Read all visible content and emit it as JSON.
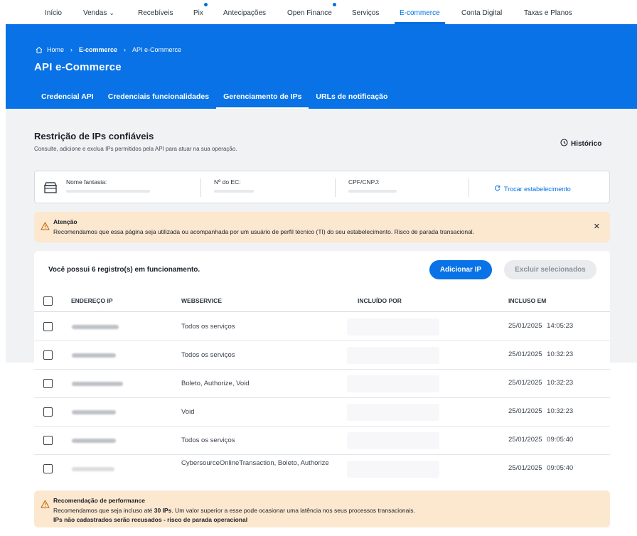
{
  "nav": {
    "items": [
      "Início",
      "Vendas",
      "Recebíveis",
      "Pix",
      "Antecipações",
      "Open Finance",
      "Serviços",
      "E-commerce",
      "Conta Digital",
      "Taxas e Planos"
    ],
    "active": "E-commerce"
  },
  "breadcrumb": {
    "home": "Home",
    "section": "E-commerce",
    "current": "API e-Commerce"
  },
  "page_title": "API e-Commerce",
  "tabs": [
    "Credencial API",
    "Credenciais funcionalidades",
    "Gerenciamento de IPs",
    "URLs de notificação"
  ],
  "section": {
    "title": "Restrição de IPs confiáveis",
    "subtitle": "Consulte, adicione e exclua IPs permitidos pela API para atuar na sua operação.",
    "history": "Histórico"
  },
  "establishment": {
    "name_label": "Nome fantasia:",
    "ec_label": "Nº do EC:",
    "doc_label": "CPF/CNPJ:",
    "switch_label": "Trocar estabelecimento"
  },
  "alert": {
    "title": "Atenção",
    "message": "Recomendamos que essa página seja utilizada ou acompanhada por um usuário de perfil técnico (TI) do seu estabelecimento. Risco de parada transacional."
  },
  "table": {
    "count_text": "Você possui 6 registro(s) em funcionamento.",
    "add_button": "Adicionar IP",
    "delete_button": "Excluir selecionados",
    "headers": {
      "ip": "ENDEREÇO IP",
      "webservice": "WEBSERVICE",
      "by": "INCLUÍDO POR",
      "date": "INCLUSO EM"
    },
    "rows": [
      {
        "webservice": "Todos os serviços",
        "by": "",
        "date": "25/01/2025 14:05:23"
      },
      {
        "webservice": "Todos os serviços",
        "by": "",
        "date": "25/01/2025 10:32:23"
      },
      {
        "webservice": "Boleto, Authorize, Void",
        "by": "",
        "date": "25/01/2025 10:32:23"
      },
      {
        "webservice": "Void",
        "by": "",
        "date": "25/01/2025 10:32:23"
      },
      {
        "webservice": "Todos os serviços",
        "by": "",
        "date": "25/01/2025 09:05:40"
      },
      {
        "webservice": "CybersourceOnlineTransaction, Boleto, Authorize",
        "by": "",
        "date": "25/01/2025 09:05:40"
      }
    ]
  },
  "performance": {
    "title": "Recomendação de performance",
    "line1_a": "Recomendamos que seja incluso até ",
    "line1_b": "30 IPs",
    "line1_c": ". Um valor superior a esse pode ocasionar uma latência nos seus processos transacionais.",
    "line2": "IPs não cadastrados serão recusados - risco de parada operacional"
  },
  "colors": {
    "primary": "#0872e6",
    "warning_bg": "#fce7cf",
    "page_bg": "#f1f2f4"
  }
}
